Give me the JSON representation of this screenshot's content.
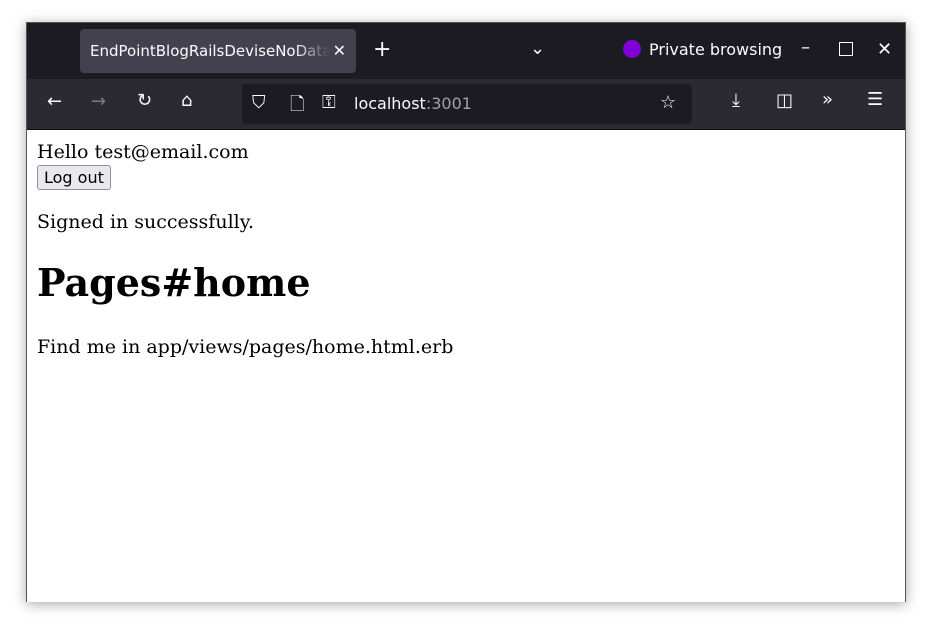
{
  "browser": {
    "tab_title": "EndPointBlogRailsDeviseNoDatabase",
    "private_label": "Private browsing",
    "url_host": "localhost",
    "url_port": ":3001",
    "accent": "#8000d7"
  },
  "page": {
    "greeting": "Hello test@email.com",
    "logout_label": "Log out",
    "notice": "Signed in successfully.",
    "heading": "Pages#home",
    "body": "Find me in app/views/pages/home.html.erb"
  }
}
